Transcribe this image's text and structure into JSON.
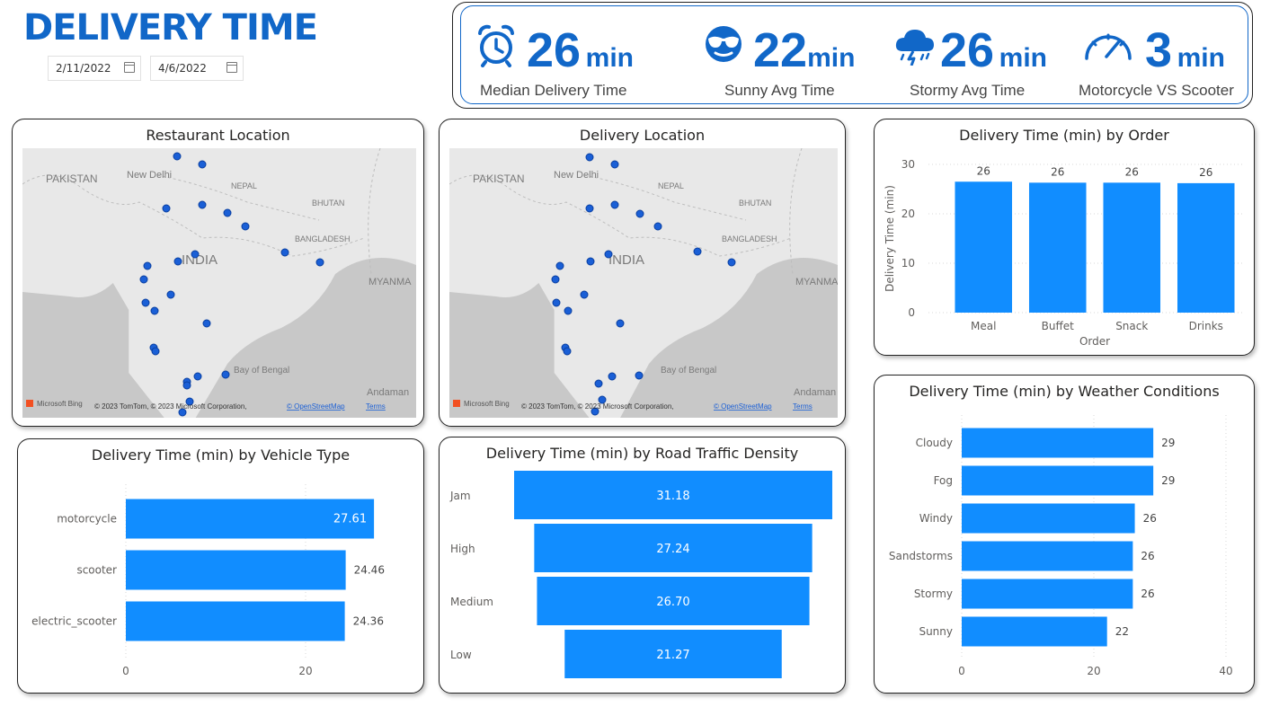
{
  "header": {
    "title": "DELIVERY TIME"
  },
  "filters": {
    "date_start": "2/11/2022",
    "date_end": "4/6/2022"
  },
  "kpis": [
    {
      "icon": "alarm-clock-icon",
      "value": "26",
      "unit": "min",
      "label": "Median Delivery Time"
    },
    {
      "icon": "sunglasses-face-icon",
      "value": "22",
      "unit": "min",
      "label": "Sunny Avg Time"
    },
    {
      "icon": "storm-cloud-icon",
      "value": "26",
      "unit": "min",
      "label": "Stormy Avg Time"
    },
    {
      "icon": "speedometer-icon",
      "value": "3",
      "unit": "min",
      "label": "Motorcycle VS Scooter"
    }
  ],
  "maps": {
    "restaurant": {
      "title": "Restaurant Location"
    },
    "delivery": {
      "title": "Delivery Location"
    },
    "labels": {
      "pakistan": "PAKISTAN",
      "newdelhi": "New Delhi",
      "nepal": "NEPAL",
      "bhutan": "BHUTAN",
      "bangladesh": "BANGLADESH",
      "india": "INDIA",
      "myanmar": "MYANMA",
      "bay": "Bay of Bengal",
      "andaman": "Andaman"
    },
    "attribution": {
      "bing": "Microsoft Bing",
      "copyright": "© 2023 TomTom, © 2023 Microsoft Corporation,",
      "osm": "© OpenStreetMap",
      "terms": "Terms"
    }
  },
  "colors": {
    "accent": "#1167c8",
    "bar": "#118dff",
    "dot": "#1a5fd6"
  },
  "chart_data": [
    {
      "id": "order",
      "type": "bar",
      "title": "Delivery Time (min) by Order",
      "categories": [
        "Meal",
        "Buffet",
        "Snack",
        "Drinks"
      ],
      "values": [
        26.5,
        26.3,
        26.3,
        26.2
      ],
      "labels": [
        "26",
        "26",
        "26",
        "26"
      ],
      "xlabel": "Order",
      "ylabel": "Delivery Time (min)",
      "ylim": [
        0,
        30
      ],
      "yticks": [
        "0",
        "10",
        "20",
        "30"
      ],
      "grid": true
    },
    {
      "id": "vehicle",
      "type": "bar",
      "orientation": "horizontal",
      "title": "Delivery Time (min) by Vehicle Type",
      "categories": [
        "motorcycle",
        "scooter",
        "electric_scooter"
      ],
      "values": [
        27.61,
        24.46,
        24.36
      ],
      "labels": [
        "27.61",
        "24.46",
        "24.36"
      ],
      "xlim": [
        0,
        30
      ],
      "xticks": [
        "0",
        "20"
      ]
    },
    {
      "id": "traffic",
      "type": "bar",
      "orientation": "horizontal-funnel",
      "title": "Delivery Time (min) by Road Traffic Density",
      "categories": [
        "Jam",
        "High",
        "Medium",
        "Low"
      ],
      "values": [
        31.18,
        27.24,
        26.7,
        21.27
      ],
      "labels": [
        "31.18",
        "27.24",
        "26.70",
        "21.27"
      ]
    },
    {
      "id": "weather",
      "type": "bar",
      "orientation": "horizontal",
      "title": "Delivery Time (min) by Weather Conditions",
      "categories": [
        "Cloudy",
        "Fog",
        "Windy",
        "Sandstorms",
        "Stormy",
        "Sunny"
      ],
      "values": [
        29,
        29,
        26.2,
        25.9,
        25.9,
        22
      ],
      "labels": [
        "29",
        "29",
        "26",
        "26",
        "26",
        "22"
      ],
      "xlim": [
        0,
        40
      ],
      "xticks": [
        "0",
        "20",
        "40"
      ]
    }
  ]
}
